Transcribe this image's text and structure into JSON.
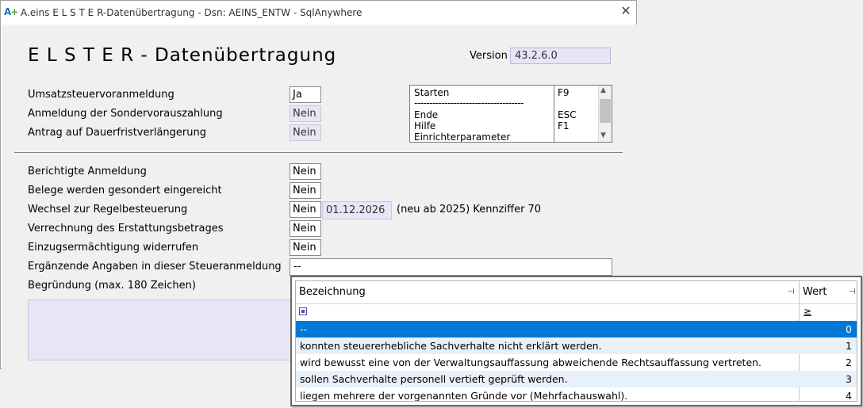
{
  "window": {
    "logo": "A",
    "title": "A.eins E L S T E R-Datenübertragung - Dsn: AEINS_ENTW - SqlAnywhere",
    "close_glyph": "✕"
  },
  "header": {
    "title": "E L S T E R - Datenübertragung",
    "version_label": "Version",
    "version_value": "43.2.6.0"
  },
  "top_fields": [
    {
      "label": "Umsatzsteuervoranmeldung",
      "value": "Ja",
      "disabled": false
    },
    {
      "label": "Anmeldung der Sondervorauszahlung",
      "value": "Nein",
      "disabled": true
    },
    {
      "label": "Antrag auf Dauerfristverlängerung",
      "value": "Nein",
      "disabled": true
    }
  ],
  "shortcuts": [
    {
      "name": "Starten",
      "key": "F9"
    },
    {
      "name": "------------------------------------",
      "key": ""
    },
    {
      "name": "Ende",
      "key": "ESC"
    },
    {
      "name": "Hilfe",
      "key": "F1"
    },
    {
      "name": "Einrichterparameter",
      "key": ""
    }
  ],
  "scroll_glyphs": {
    "up": "▲",
    "down": "▼"
  },
  "fields": [
    {
      "label": "Berichtigte Anmeldung",
      "value": "Nein"
    },
    {
      "label": "Belege werden gesondert eingereicht",
      "value": "Nein"
    },
    {
      "label": "Wechsel zur Regelbesteuerung",
      "value": "Nein"
    },
    {
      "label": "Verrechnung des Erstattungsbetrages",
      "value": "Nein"
    },
    {
      "label": "Einzugsermächtigung widerrufen",
      "value": "Nein"
    }
  ],
  "wechsel": {
    "date": "01.12.2026",
    "note": "(neu ab 2025) Kennziffer 70"
  },
  "ergaenzende": {
    "label": "Ergänzende Angaben in dieser Steueranmeldung",
    "value": "--"
  },
  "begruendung": {
    "label": "Begründung (max. 180 Zeichen)",
    "value": ""
  },
  "dropdown": {
    "col_bezeichnung": "Bezeichnung",
    "col_wert": "Wert",
    "pin_glyph": "⊣",
    "filter_operator": "≥",
    "rows": [
      {
        "text": "--",
        "value": "0",
        "selected": true
      },
      {
        "text": "konnten steuererhebliche Sachverhalte nicht erklärt werden.",
        "value": "1",
        "selected": false
      },
      {
        "text": "wird bewusst eine von der Verwaltungsauffassung abweichende Rechtsauffassung vertreten.",
        "value": "2",
        "selected": false
      },
      {
        "text": "sollen Sachverhalte personell vertieft geprüft werden.",
        "value": "3",
        "selected": false
      },
      {
        "text": "liegen mehrere der vorgenannten Gründe vor (Mehrfachauswahl).",
        "value": "4",
        "selected": false
      }
    ]
  }
}
